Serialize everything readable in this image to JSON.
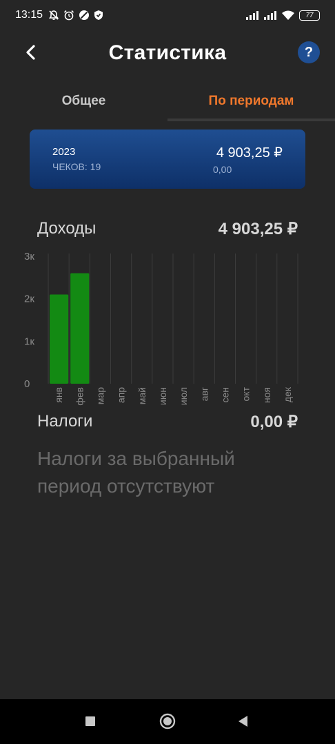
{
  "status_bar": {
    "time": "13:15",
    "battery": "77"
  },
  "header": {
    "title": "Статистика",
    "help_label": "?"
  },
  "tabs": [
    {
      "label": "Общее",
      "active": false
    },
    {
      "label": "По периодам",
      "active": true
    }
  ],
  "period_card": {
    "year": "2023",
    "checks": "ЧЕКОВ: 19",
    "amount": "4 903,25 ₽",
    "secondary": "0,00"
  },
  "income": {
    "label": "Доходы",
    "total": "4 903,25 ₽"
  },
  "taxes": {
    "label": "Налоги",
    "total": "0,00 ₽",
    "empty_text": "Налоги за выбранный период отсутствуют"
  },
  "colors": {
    "background": "#262626",
    "accent_orange": "#f0782c",
    "card_blue": "#1f4e91",
    "bar_green": "#138a13",
    "help_blue": "#1f4f94"
  },
  "chart_data": {
    "type": "bar",
    "categories": [
      "янв",
      "фев",
      "мар",
      "апр",
      "май",
      "июн",
      "июл",
      "авг",
      "сен",
      "окт",
      "ноя",
      "дек"
    ],
    "values": [
      2100,
      2600,
      0,
      0,
      0,
      0,
      0,
      0,
      0,
      0,
      0,
      0
    ],
    "y_ticks": [
      "0",
      "1к",
      "2к",
      "3к"
    ],
    "ylim": [
      0,
      3000
    ],
    "title": "",
    "xlabel": "",
    "ylabel": "",
    "grid": true
  }
}
